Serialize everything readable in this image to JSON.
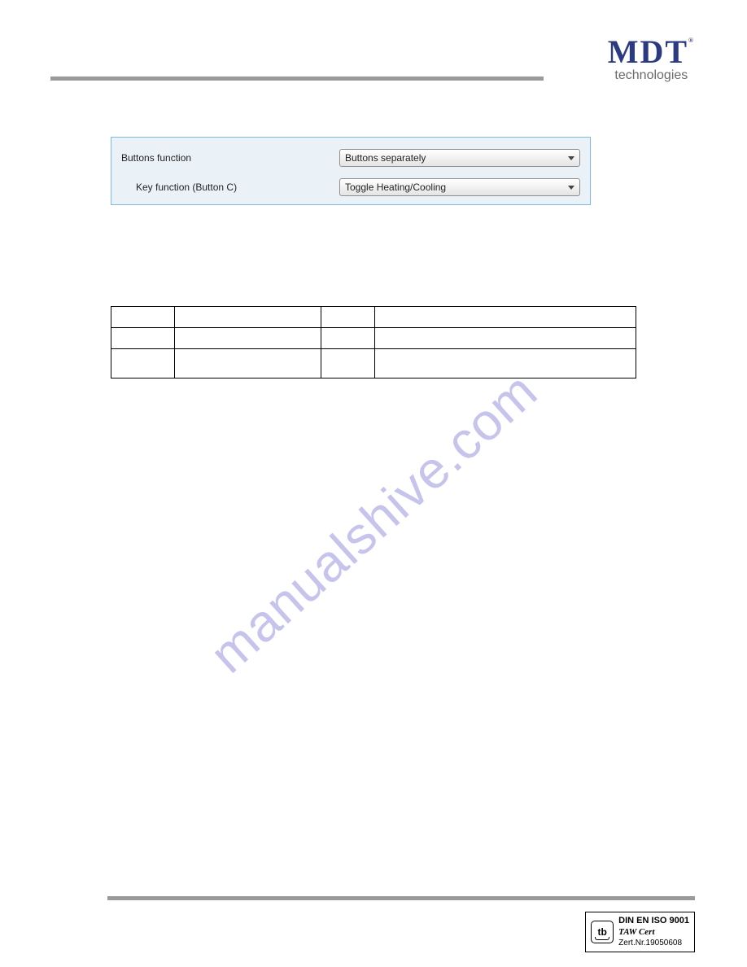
{
  "header": {
    "logo_text": "MDT",
    "logo_subtext": "technologies",
    "logo_reg": "®"
  },
  "panel": {
    "row1_label": "Buttons function",
    "row1_value": "Buttons separately",
    "row2_label": "Key function (Button C)",
    "row2_value": "Toggle Heating/Cooling"
  },
  "watermark": "manualshive.com",
  "table": {
    "rows": [
      [
        "",
        "",
        "",
        ""
      ],
      [
        "",
        "",
        "",
        ""
      ],
      [
        "",
        "",
        "",
        ""
      ]
    ]
  },
  "cert": {
    "line1": "DIN EN ISO 9001",
    "line2a": "TAW ",
    "line2b": "Cert",
    "line3": "Zert.Nr.19050608",
    "icon_text": "tb"
  }
}
